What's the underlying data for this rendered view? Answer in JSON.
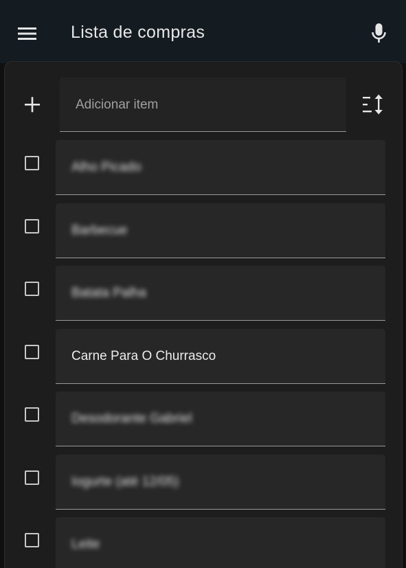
{
  "app": {
    "title": "Lista de compras"
  },
  "add_item": {
    "placeholder": "Adicionar item"
  },
  "items": [
    {
      "text": "Alho Picado",
      "blurred": true
    },
    {
      "text": "Barbecue",
      "blurred": true
    },
    {
      "text": "Batata Palha",
      "blurred": true
    },
    {
      "text": "Carne Para O Churrasco",
      "blurred": false
    },
    {
      "text": "Desodorante Gabriel",
      "blurred": true
    },
    {
      "text": "Iogurte (até 12/05)",
      "blurred": true
    },
    {
      "text": "Leite",
      "blurred": true
    }
  ],
  "icons": {
    "menu": "menu-icon",
    "mic": "microphone-icon",
    "add": "plus-icon",
    "sort": "sort-icon"
  },
  "colors": {
    "topbar": "#151c21",
    "card": "#1d1d1d",
    "field": "#272727",
    "text": "#ececec"
  }
}
